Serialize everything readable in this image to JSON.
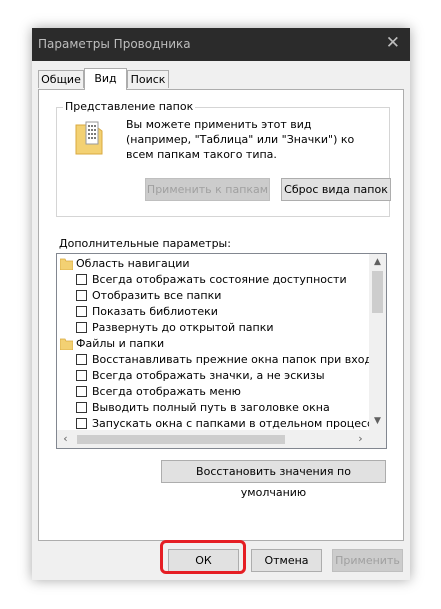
{
  "window": {
    "title": "Параметры Проводника",
    "close_glyph": "✕"
  },
  "tabs": [
    {
      "label": "Общие",
      "active": false
    },
    {
      "label": "Вид",
      "active": true
    },
    {
      "label": "Поиск",
      "active": false
    }
  ],
  "folder_views": {
    "legend": "Представление папок",
    "description": "Вы можете применить этот вид (например, \"Таблица\" или \"Значки\") ко всем папкам такого типа.",
    "apply_button": "Применить к папкам",
    "reset_button": "Сброс вида папок"
  },
  "advanced": {
    "label": "Дополнительные параметры:",
    "items": [
      {
        "type": "folder",
        "label": "Область навигации"
      },
      {
        "type": "checkbox",
        "label": "Всегда отображать состояние доступности",
        "checked": false
      },
      {
        "type": "checkbox",
        "label": "Отобразить все папки",
        "checked": false
      },
      {
        "type": "checkbox",
        "label": "Показать библиотеки",
        "checked": false
      },
      {
        "type": "checkbox",
        "label": "Развернуть до открытой папки",
        "checked": false
      },
      {
        "type": "folder",
        "label": "Файлы и папки"
      },
      {
        "type": "checkbox",
        "label": "Восстанавливать прежние окна папок при входе в си",
        "checked": false
      },
      {
        "type": "checkbox",
        "label": "Всегда отображать значки, а не эскизы",
        "checked": false
      },
      {
        "type": "checkbox",
        "label": "Всегда отображать меню",
        "checked": false
      },
      {
        "type": "checkbox",
        "label": "Выводить полный путь в заголовке окна",
        "checked": false
      },
      {
        "type": "checkbox",
        "label": "Запускать окна с папками в отдельном процессе",
        "checked": false
      }
    ],
    "restore_defaults_button": "Восстановить значения по умолчанию"
  },
  "footer": {
    "ok": "ОК",
    "cancel": "Отмена",
    "apply": "Применить"
  },
  "colors": {
    "highlight": "#e51e24",
    "folder": "#f3d173",
    "titlebar": "#2b2b2b"
  }
}
